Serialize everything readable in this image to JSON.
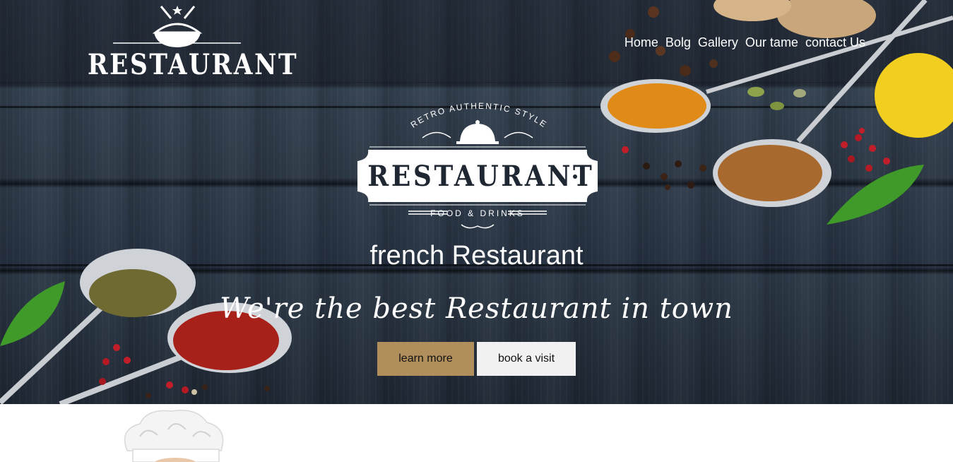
{
  "header": {
    "logo_text": "RESTAURANT",
    "nav": [
      "Home",
      "Bolg",
      "Gallery",
      "Our tame",
      "contact Us"
    ]
  },
  "hero": {
    "badge": {
      "arc_text": "RETRO AUTHENTIC STYLE",
      "title": "RESTAURANT",
      "subtitle": "FOOD & DRINKS"
    },
    "headline": "french Restaurant",
    "tagline": "We're the best Restaurant in town",
    "buttons": {
      "learn_more": "learn more",
      "book_visit": "book a visit"
    }
  },
  "colors": {
    "accent": "#b08f5c",
    "secondary_button": "#f1f1f1",
    "hero_background": "#2a3441",
    "text_light": "#ffffff"
  },
  "icons": [
    "bowl-noodles-icon",
    "cloche-icon",
    "chef-hat-image"
  ]
}
